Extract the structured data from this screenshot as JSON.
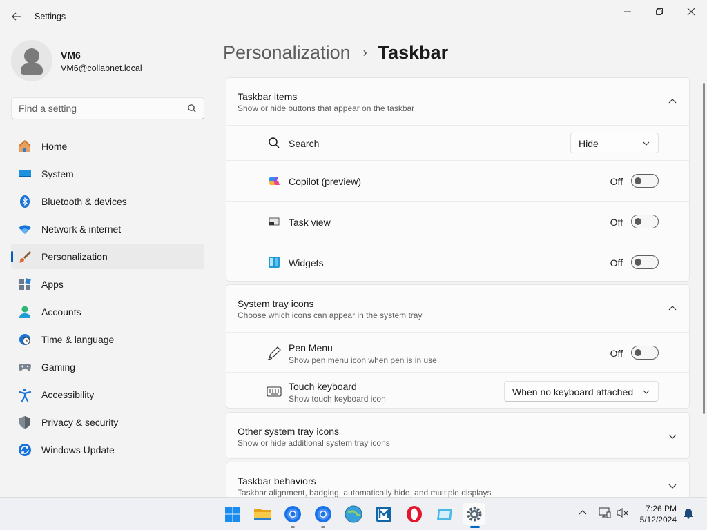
{
  "window": {
    "title": "Settings",
    "controls": [
      "minimize",
      "maximize",
      "close"
    ]
  },
  "profile": {
    "name": "VM6",
    "email": "VM6@collabnet.local"
  },
  "search": {
    "placeholder": "Find a setting"
  },
  "sidebar": {
    "items": [
      {
        "label": "Home",
        "icon": "home-icon"
      },
      {
        "label": "System",
        "icon": "system-icon"
      },
      {
        "label": "Bluetooth & devices",
        "icon": "bluetooth-icon"
      },
      {
        "label": "Network & internet",
        "icon": "wifi-icon"
      },
      {
        "label": "Personalization",
        "icon": "brush-icon",
        "selected": true
      },
      {
        "label": "Apps",
        "icon": "apps-icon"
      },
      {
        "label": "Accounts",
        "icon": "accounts-icon"
      },
      {
        "label": "Time & language",
        "icon": "clock-globe-icon"
      },
      {
        "label": "Gaming",
        "icon": "gamepad-icon"
      },
      {
        "label": "Accessibility",
        "icon": "accessibility-icon"
      },
      {
        "label": "Privacy & security",
        "icon": "shield-icon"
      },
      {
        "label": "Windows Update",
        "icon": "update-icon"
      }
    ]
  },
  "breadcrumb": {
    "parent": "Personalization",
    "separator": "›",
    "current": "Taskbar"
  },
  "sections": {
    "taskbar_items": {
      "title": "Taskbar items",
      "subtitle": "Show or hide buttons that appear on the taskbar",
      "expanded": true,
      "rows": [
        {
          "label": "Search",
          "icon": "search-icon",
          "control": "dropdown",
          "value": "Hide"
        },
        {
          "label": "Copilot (preview)",
          "icon": "copilot-icon",
          "control": "toggle",
          "state": "Off"
        },
        {
          "label": "Task view",
          "icon": "task-view-icon",
          "control": "toggle",
          "state": "Off"
        },
        {
          "label": "Widgets",
          "icon": "widgets-icon",
          "control": "toggle",
          "state": "Off"
        }
      ]
    },
    "system_tray": {
      "title": "System tray icons",
      "subtitle": "Choose which icons can appear in the system tray",
      "expanded": true,
      "rows": [
        {
          "label": "Pen Menu",
          "sub": "Show pen menu icon when pen is in use",
          "icon": "pen-icon",
          "control": "toggle",
          "state": "Off"
        },
        {
          "label": "Touch keyboard",
          "sub": "Show touch keyboard icon",
          "icon": "keyboard-icon",
          "control": "dropdown",
          "value": "When no keyboard attached"
        }
      ]
    },
    "other_tray": {
      "title": "Other system tray icons",
      "subtitle": "Show or hide additional system tray icons",
      "expanded": false
    },
    "behaviors": {
      "title": "Taskbar behaviors",
      "subtitle": "Taskbar alignment, badging, automatically hide, and multiple displays",
      "expanded": false
    }
  },
  "taskbar": {
    "apps": [
      "windows-start-icon",
      "file-explorer-icon",
      "chrome-icon",
      "chrome-icon",
      "browser-globe-icon",
      "app-m-icon",
      "opera-icon",
      "app-window-icon",
      "settings-gear-icon"
    ],
    "active_app": "settings-gear-icon",
    "tray": [
      "chevron-up-icon",
      "display-icon",
      "volume-mute-icon"
    ],
    "time": "7:26 PM",
    "date": "5/12/2024"
  },
  "colors": {
    "accent": "#005fb8",
    "background": "#f3f3f3",
    "card": "#fbfbfb"
  }
}
